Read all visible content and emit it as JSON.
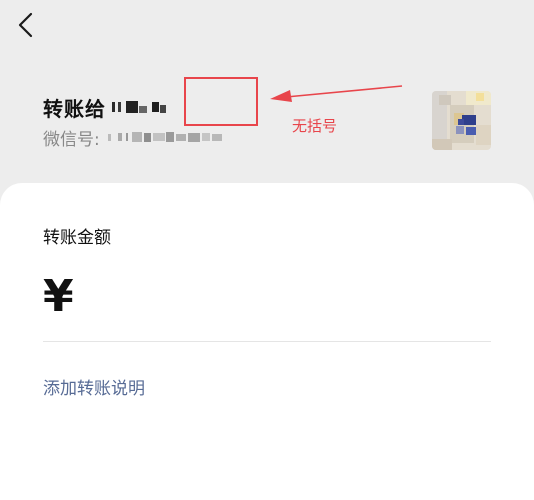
{
  "header": {
    "back_icon": "chevron-left-icon"
  },
  "recipient": {
    "title_prefix": "转账给",
    "wechat_id_label": "微信号:"
  },
  "annotation": {
    "text": "无括号",
    "color": "#e8454b"
  },
  "form": {
    "amount_label": "转账金额",
    "currency_symbol": "¥",
    "add_note_link": "添加转账说明"
  },
  "colors": {
    "link": "#576b95",
    "background": "#ededed",
    "card": "#ffffff"
  }
}
